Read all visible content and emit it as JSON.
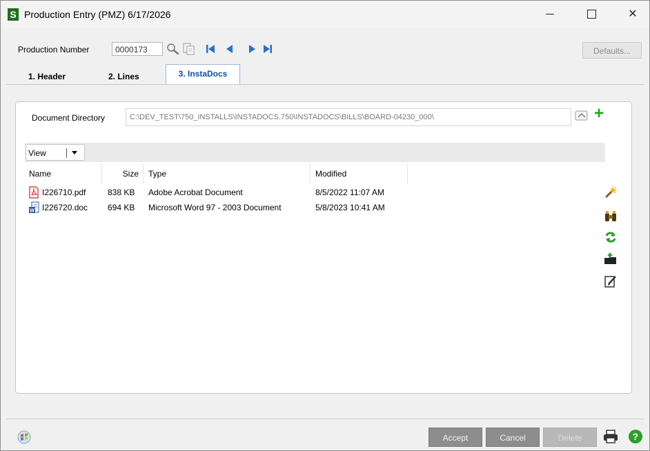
{
  "window": {
    "title": "Production Entry (PMZ) 6/17/2026",
    "app_icon_letter": "S"
  },
  "header": {
    "production_number_label": "Production Number",
    "production_number_value": "0000173",
    "defaults_label": "Defaults...",
    "icons": [
      "lookup-icon",
      "copy-icon",
      "first-record-icon",
      "previous-record-icon",
      "next-record-icon",
      "last-record-icon"
    ]
  },
  "tabs": [
    {
      "label": "1. Header",
      "active": false
    },
    {
      "label": "2. Lines",
      "active": false
    },
    {
      "label": "3. InstaDocs",
      "active": true
    }
  ],
  "instadocs": {
    "directory_label": "Document Directory",
    "directory_value": "C:\\DEV_TEST\\750_INSTALLS\\INSTADOCS.750\\INSTADOCS\\BILLS\\BOARD-04230_000\\",
    "view_label": "View",
    "columns": [
      "Name",
      "Size",
      "Type",
      "Modified"
    ],
    "files": [
      {
        "name": "I226710.pdf",
        "size": "838 KB",
        "type": "Adobe Acrobat Document",
        "modified": "8/5/2022 11:07 AM",
        "icon": "pdf-icon"
      },
      {
        "name": "I226720.doc",
        "size": "694 KB",
        "type": "Microsoft Word 97 - 2003 Document",
        "modified": "5/8/2023 10:41 AM",
        "icon": "word-doc-icon"
      }
    ],
    "side_icons": [
      "magic-wand-icon",
      "binoculars-icon",
      "refresh-icon",
      "upload-folder-icon",
      "edit-icon"
    ]
  },
  "footer": {
    "accept_label": "Accept",
    "cancel_label": "Cancel",
    "delete_label": "Delete"
  },
  "colors": {
    "active_tab_text": "#0b4fa8",
    "button_bg": "#8d8d8d",
    "app_icon": "#1f6e1f",
    "add_plus": "#1fa31f"
  }
}
